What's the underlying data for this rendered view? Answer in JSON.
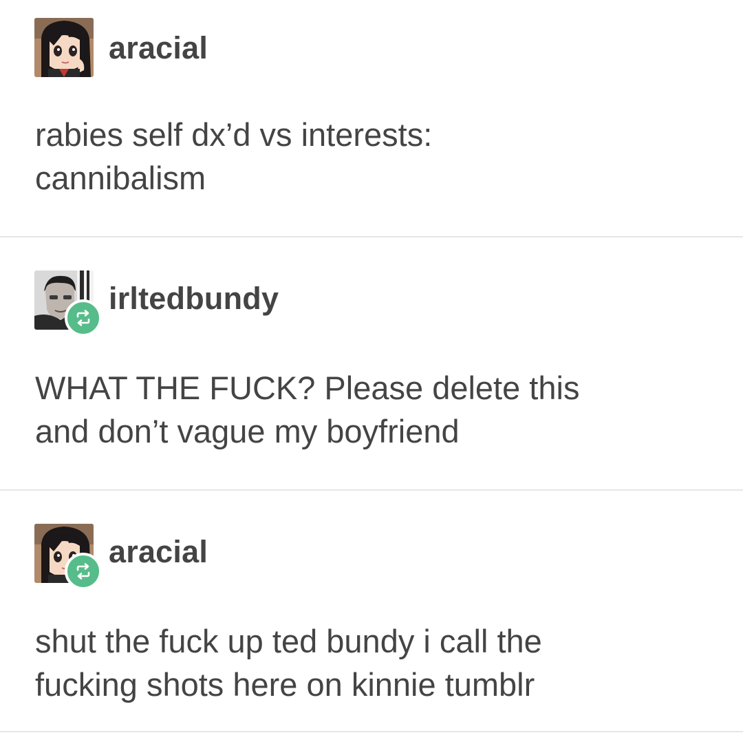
{
  "posts": [
    {
      "username": "aracial",
      "avatar_icon": "anime-girl-avatar-icon",
      "reblogged": false,
      "text": "rabies self dx’d vs interests:\ncannibalism"
    },
    {
      "username": "irltedbundy",
      "avatar_icon": "man-portrait-avatar-icon",
      "reblogged": true,
      "text": "WHAT THE FUCK? Please delete this\nand don’t vague my boyfriend"
    },
    {
      "username": "aracial",
      "avatar_icon": "anime-girl-avatar-icon",
      "reblogged": true,
      "text": "shut the fuck up ted bundy i call the\nfucking shots here on kinnie tumblr"
    }
  ],
  "colors": {
    "text": "#444444",
    "divider": "#e6e6e6",
    "reblog_badge": "#56bc8a",
    "background": "#ffffff"
  },
  "icons": {
    "reblog_badge": "reblog-icon"
  }
}
